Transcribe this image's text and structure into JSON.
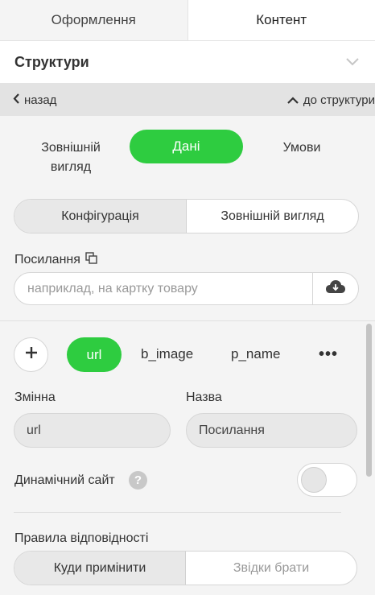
{
  "tabs": {
    "design": "Оформлення",
    "content": "Контент"
  },
  "section": {
    "title": "Структури"
  },
  "nav": {
    "back": "назад",
    "up": "до структури"
  },
  "mode": {
    "appearance_line1": "Зовнішній",
    "appearance_line2": "вигляд",
    "data": "Дані",
    "conditions": "Умови"
  },
  "subtabs": {
    "config": "Конфігурація",
    "appearance": "Зовнішній вигляд"
  },
  "link": {
    "label": "Посилання",
    "placeholder": "наприклад, на картку товару",
    "value": ""
  },
  "variables": {
    "items": [
      "url",
      "b_image",
      "p_name"
    ],
    "more": "•••"
  },
  "variable": {
    "name_label": "Змінна",
    "title_label": "Назва",
    "name_value": "url",
    "title_value": "Посилання"
  },
  "dynamic": {
    "label": "Динамічний сайт",
    "help": "?",
    "enabled": false
  },
  "rules": {
    "label": "Правила відповідності",
    "apply_to": "Куди примінити",
    "source": "Звідки брати"
  },
  "colors": {
    "accent": "#2ecc40"
  }
}
